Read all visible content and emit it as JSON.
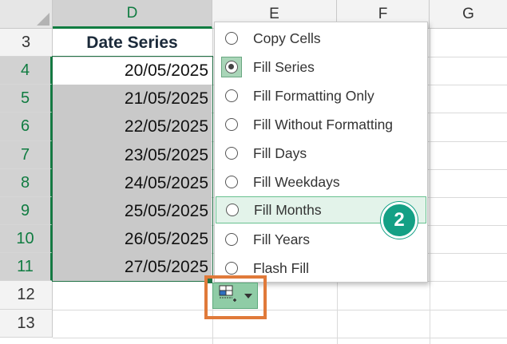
{
  "columns": [
    {
      "label": "D",
      "selected": true
    },
    {
      "label": "E",
      "selected": false
    },
    {
      "label": "F",
      "selected": false
    },
    {
      "label": "G",
      "selected": false
    }
  ],
  "rows": [
    "3",
    "4",
    "5",
    "6",
    "7",
    "8",
    "9",
    "10",
    "11",
    "12",
    "13"
  ],
  "header_cell": "Date Series",
  "dates": [
    "20/05/2025",
    "21/05/2025",
    "22/05/2025",
    "23/05/2025",
    "24/05/2025",
    "25/05/2025",
    "26/05/2025",
    "27/05/2025"
  ],
  "menu": {
    "items": [
      {
        "label": "Copy Cells",
        "checked": false
      },
      {
        "label": "Fill Series",
        "checked": true
      },
      {
        "label": "Fill Formatting Only",
        "checked": false
      },
      {
        "label": "Fill Without Formatting",
        "checked": false
      },
      {
        "label": "Fill Days",
        "checked": false
      },
      {
        "label": "Fill Weekdays",
        "checked": false
      },
      {
        "label": "Fill Months",
        "checked": false,
        "highlighted": true
      },
      {
        "label": "Fill Years",
        "checked": false
      },
      {
        "label": "Flash Fill",
        "checked": false
      }
    ]
  },
  "step_badge": "2",
  "colors": {
    "accent": "#217346",
    "badge": "#14a085",
    "highlight_frame": "#e07a3a"
  },
  "icons": {
    "autofill_options": "autofill-options-icon"
  }
}
